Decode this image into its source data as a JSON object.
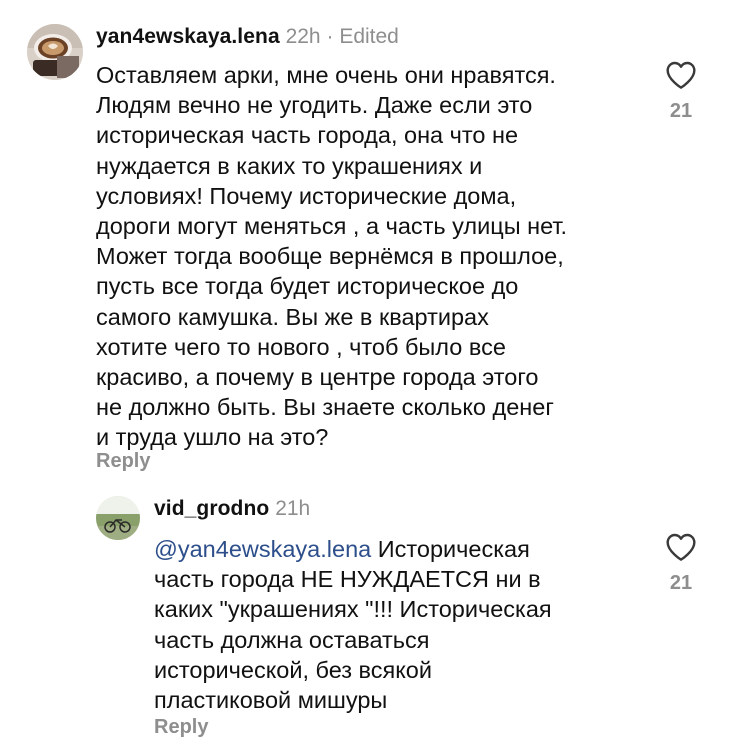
{
  "comments": [
    {
      "username": "yan4ewskaya.lena",
      "time": "22h",
      "separator": "·",
      "edited": "Edited",
      "text": "Оставляем арки, мне очень они нравятся.\nЛюдям вечно не угодить. Даже если это\nисторическая часть города, она  что не\nнуждается в каких то  украшениях и\nусловиях!  Почему исторические дома,\nдороги могут меняться , а часть улицы нет.\nМожет тогда вообще вернёмся в прошлое,\nпусть все тогда будет историческое до\nсамого камушка. Вы же в квартирах\nхотите чего то нового , чтоб было все\nкрасиво, а почему в центре города этого\nне должно быть. Вы знаете сколько денег\nи труда ушло на это?",
      "reply_label": "Reply",
      "like_icon": "heart-outline-icon",
      "likes": "21"
    }
  ],
  "replies": [
    {
      "username": "vid_grodno",
      "time": "21h",
      "mention": "@yan4ewskaya.lena",
      "text": " Историческая\nчасть города НЕ НУЖДАЕТСЯ ни в\nкаких \"украшениях \"!!! Историческая\nчасть должна оставаться\nисторической, без всякой\nпластиковой мишуры",
      "reply_label": "Reply",
      "like_icon": "heart-outline-icon",
      "likes": "21"
    }
  ],
  "colors": {
    "text": "#111111",
    "secondary": "#8e8e8e",
    "mention": "#2c4e8a"
  }
}
